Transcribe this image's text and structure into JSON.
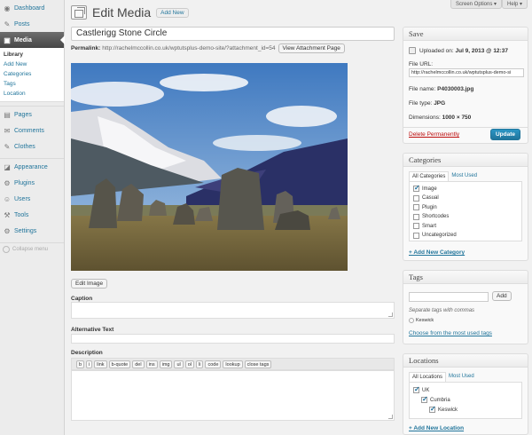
{
  "sidebar": {
    "items": [
      {
        "label": "Dashboard",
        "icon": "dashboard-icon",
        "glyph": "◉"
      },
      {
        "label": "Posts",
        "icon": "pin-icon",
        "glyph": "✎"
      },
      {
        "label": "Media",
        "icon": "media-icon",
        "glyph": "▣"
      }
    ],
    "media_submenu": [
      "Library",
      "Add New",
      "Categories",
      "Tags",
      "Location"
    ],
    "items2": [
      {
        "label": "Pages",
        "icon": "page-icon",
        "glyph": "▤"
      },
      {
        "label": "Comments",
        "icon": "comment-icon",
        "glyph": "✉"
      },
      {
        "label": "Clothes",
        "icon": "pin-icon",
        "glyph": "✎"
      }
    ],
    "items3": [
      {
        "label": "Appearance",
        "icon": "brush-icon",
        "glyph": "◪"
      },
      {
        "label": "Plugins",
        "icon": "plug-icon",
        "glyph": "⚙"
      },
      {
        "label": "Users",
        "icon": "users-icon",
        "glyph": "☺"
      },
      {
        "label": "Tools",
        "icon": "wrench-icon",
        "glyph": "⚒"
      },
      {
        "label": "Settings",
        "icon": "settings-icon",
        "glyph": "⚙"
      }
    ],
    "collapse_label": "Collapse menu"
  },
  "top": {
    "screen_options": "Screen Options ▾",
    "help": "Help ▾"
  },
  "header": {
    "title": "Edit Media",
    "add_new": "Add New"
  },
  "main": {
    "title_value": "Castlerigg Stone Circle",
    "permalink_label": "Permalink:",
    "permalink_url": "http://rachelmccollin.co.uk/wptutsplus-demo-site/?attachment_id=54",
    "view_attachment": "View Attachment Page",
    "edit_image": "Edit Image",
    "caption_label": "Caption",
    "alt_label": "Alternative Text",
    "description_label": "Description",
    "quicktags": [
      "b",
      "i",
      "link",
      "b-quote",
      "del",
      "ins",
      "img",
      "ul",
      "ol",
      "li",
      "code",
      "lookup",
      "close tags"
    ]
  },
  "save_box": {
    "title": "Save",
    "uploaded_prefix": "Uploaded on:",
    "uploaded_date": "Jul 9, 2013 @ 12:37",
    "file_url_label": "File URL:",
    "file_url": "http://rachelmccollin.co.uk/wptutsplus-demo-si",
    "file_name_label": "File name:",
    "file_name": "P4030003.jpg",
    "file_type_label": "File type:",
    "file_type": "JPG",
    "dimensions_label": "Dimensions:",
    "dimensions": "1000 × 750",
    "delete": "Delete Permanently",
    "update": "Update"
  },
  "categories_box": {
    "title": "Categories",
    "tabs": [
      "All Categories",
      "Most Used"
    ],
    "items": [
      {
        "label": "Image",
        "checked": true
      },
      {
        "label": "Casual",
        "checked": false
      },
      {
        "label": "Plugin",
        "checked": false
      },
      {
        "label": "Shortcodes",
        "checked": false
      },
      {
        "label": "Smart",
        "checked": false
      },
      {
        "label": "Uncategorized",
        "checked": false
      }
    ],
    "add_new": "+ Add New Category"
  },
  "tags_box": {
    "title": "Tags",
    "add": "Add",
    "hint": "Separate tags with commas",
    "tag": "Keswick",
    "choose": "Choose from the most used tags"
  },
  "locations_box": {
    "title": "Locations",
    "tabs": [
      "All Locations",
      "Most Used"
    ],
    "items": [
      {
        "label": "UK",
        "checked": true,
        "level": 0
      },
      {
        "label": "Cumbria",
        "checked": true,
        "level": 1
      },
      {
        "label": "Keswick",
        "checked": true,
        "level": 2
      }
    ],
    "add_new": "+ Add New Location"
  },
  "colors": {
    "link": "#21759b",
    "active_menu": "#464646",
    "delete": "#bc0b0b",
    "primary": "#21759b"
  }
}
